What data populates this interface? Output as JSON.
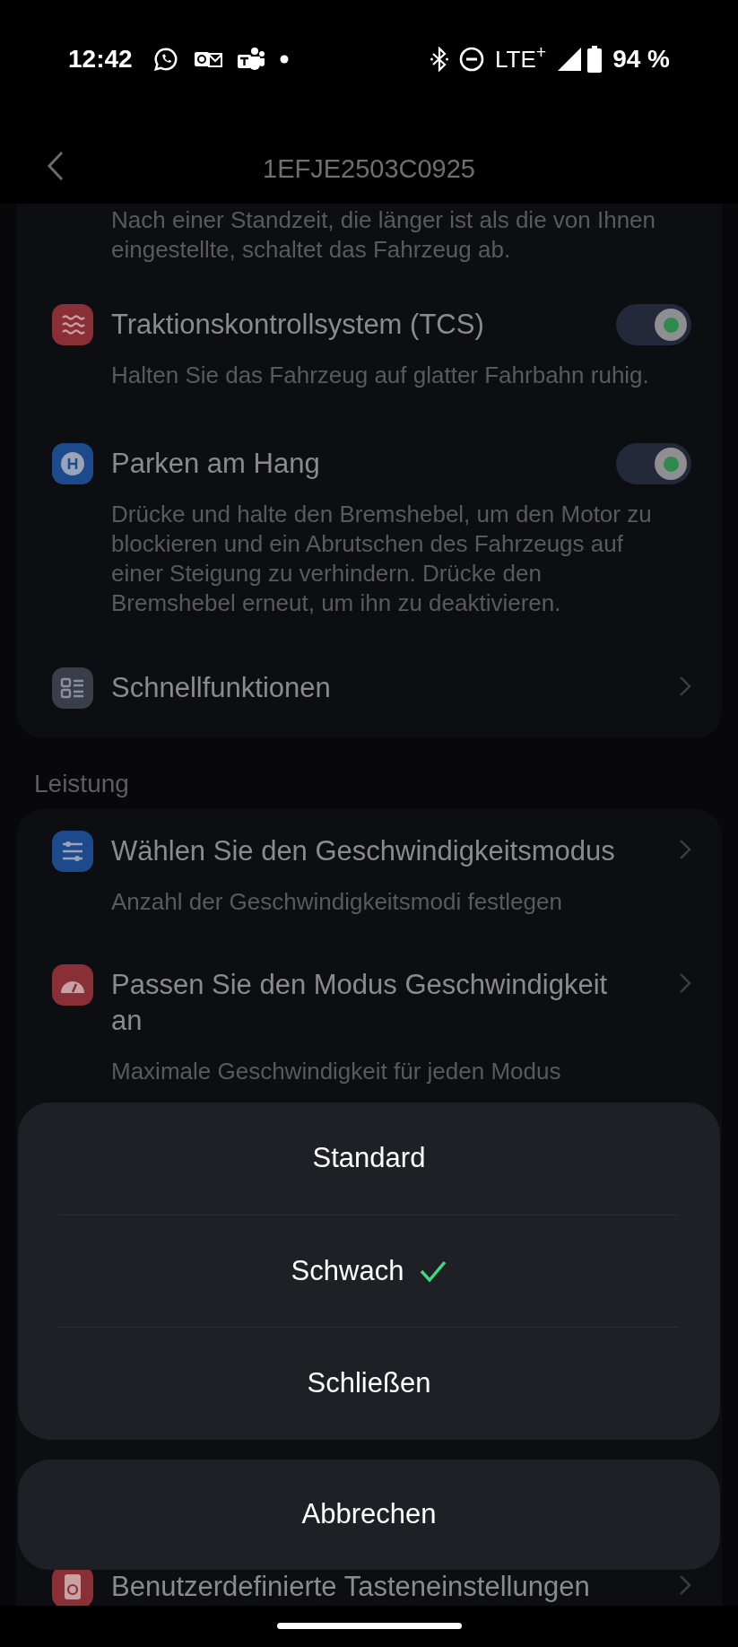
{
  "status_bar": {
    "time": "12:42",
    "network": "LTE$^{+}$",
    "battery": "94 %"
  },
  "header": {
    "title": "1EFJE2503C0925"
  },
  "groups": [
    {
      "items": [
        {
          "kind": "note",
          "description": "Nach einer Standzeit, die länger ist als die von Ihnen eingestellte, schaltet das Fahrzeug ab."
        },
        {
          "kind": "toggle",
          "color": "#8a2f35",
          "title": "Traktionskontrollsystem (TCS)",
          "description": "Halten Sie das Fahrzeug auf glatter Fahrbahn ruhig.",
          "on": true
        },
        {
          "kind": "toggle",
          "color": "#1d4a8c",
          "title": "Parken am Hang",
          "description": "Drücke und halte den Bremshebel, um den Motor zu blockieren und ein Abrutschen des Fahrzeugs auf einer Steigung zu verhindern. Drücke den Bremshebel erneut, um ihn zu deaktivieren.",
          "on": true
        },
        {
          "kind": "link",
          "color": "#3a3d4a",
          "title": "Schnellfunktionen"
        }
      ]
    },
    {
      "heading": "Leistung",
      "items": [
        {
          "kind": "link",
          "color": "#1d4a8c",
          "title": "Wählen Sie den Geschwindigkeitsmodus",
          "description": "Anzahl der Geschwindigkeitsmodi festlegen"
        },
        {
          "kind": "link",
          "color": "#8a2f35",
          "title": "Passen Sie den Modus Geschwindigkeit an",
          "description": "Maximale Geschwindigkeit für jeden Modus"
        },
        {
          "kind": "link",
          "color": "#8a2f35",
          "title": "Benutzerdefinierte Tasteneinstellungen"
        }
      ]
    }
  ],
  "sheet": {
    "options": [
      {
        "label": "Standard",
        "selected": false
      },
      {
        "label": "Schwach",
        "selected": true
      },
      {
        "label": "Schließen",
        "selected": false
      }
    ],
    "cancel": "Abbrechen"
  }
}
